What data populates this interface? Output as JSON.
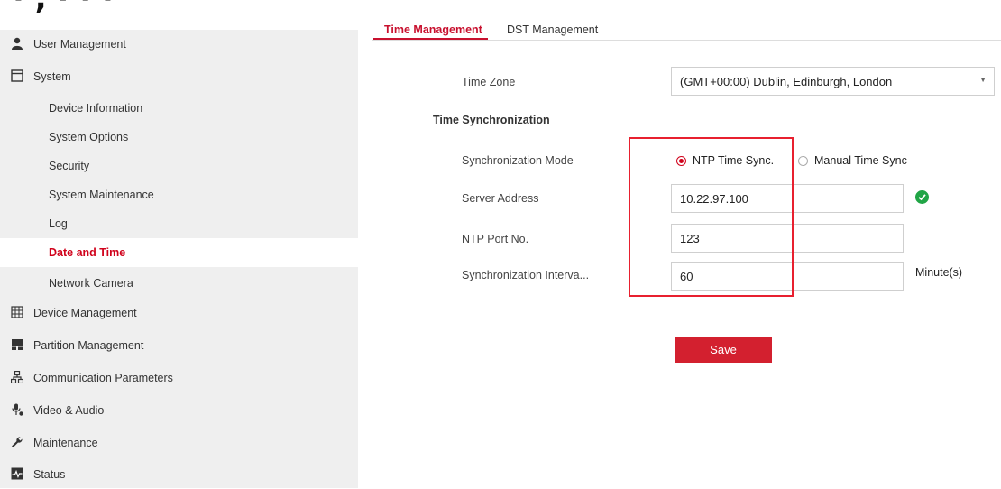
{
  "header": {
    "fragment": "· ,  ·  ·  ·   "
  },
  "sidebar": {
    "items": [
      {
        "label": "User Management",
        "icon": "user-icon"
      },
      {
        "label": "System",
        "icon": "system-icon"
      },
      {
        "label": "Device Information"
      },
      {
        "label": "System Options"
      },
      {
        "label": "Security"
      },
      {
        "label": "System Maintenance"
      },
      {
        "label": "Log"
      },
      {
        "label": "Date and Time",
        "active": true
      },
      {
        "label": "Network Camera"
      },
      {
        "label": "Device Management",
        "icon": "device-grid-icon"
      },
      {
        "label": "Partition Management",
        "icon": "partition-icon"
      },
      {
        "label": "Communication Parameters",
        "icon": "network-icon"
      },
      {
        "label": "Video & Audio",
        "icon": "microphone-icon"
      },
      {
        "label": "Maintenance",
        "icon": "wrench-icon"
      },
      {
        "label": "Status",
        "icon": "status-icon"
      }
    ]
  },
  "tabs": [
    {
      "label": "Time Management",
      "active": true
    },
    {
      "label": "DST Management"
    }
  ],
  "form": {
    "time_zone_label": "Time Zone",
    "time_zone_value": "(GMT+00:00) Dublin, Edinburgh, London",
    "section_title": "Time Synchronization",
    "sync_mode_label": "Synchronization Mode",
    "ntp_option": "NTP Time Sync.",
    "manual_option": "Manual Time Sync",
    "server_label": "Server Address",
    "server_value": "10.22.97.100",
    "port_label": "NTP Port No.",
    "port_value": "123",
    "interval_label": "Synchronization Interva...",
    "interval_value": "60",
    "interval_unit": "Minute(s)",
    "save_label": "Save"
  },
  "colors": {
    "accent": "#d0021b",
    "ok": "#21a546",
    "highlight": "#e8202f"
  }
}
